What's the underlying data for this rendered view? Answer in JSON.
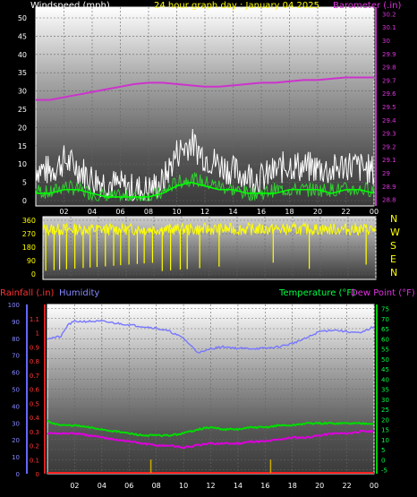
{
  "chart_data": [
    {
      "type": "line",
      "panel": "wind_barometer",
      "title": "24 hour graph day : January 04 2025",
      "left_axis_label": "Windspeed (mph)",
      "right_axis_label": "Barometer (.in)",
      "x_tick_labels": [
        "02",
        "04",
        "06",
        "08",
        "10",
        "12",
        "14",
        "16",
        "18",
        "20",
        "22",
        "00"
      ],
      "left_ticks": [
        0,
        5,
        10,
        15,
        20,
        25,
        30,
        35,
        40,
        45,
        50
      ],
      "left_range": [
        0,
        50
      ],
      "right_ticks": [
        "28.8",
        "28.9",
        "29",
        "29.1",
        "29.2",
        "29.3",
        "29.4",
        "29.5",
        "29.6",
        "29.7",
        "29.8",
        "29.9",
        "30",
        "30.1",
        "30.2"
      ],
      "right_range": [
        28.75,
        30.25
      ],
      "colors": {
        "gust": "#ffffff",
        "wind": "#33cc33",
        "average": "#00ff00",
        "barometer": "#cc33cc"
      },
      "series": [
        {
          "key": "barometer",
          "axis": "right",
          "x": [
            0,
            1,
            2,
            3,
            4,
            5,
            6,
            7,
            8,
            9,
            10,
            11,
            12,
            13,
            14,
            15,
            16,
            17,
            18,
            19,
            20,
            21,
            22,
            23,
            24
          ],
          "values": [
            29.55,
            29.55,
            29.57,
            29.59,
            29.61,
            29.63,
            29.65,
            29.67,
            29.68,
            29.68,
            29.67,
            29.66,
            29.65,
            29.65,
            29.66,
            29.67,
            29.68,
            29.68,
            29.69,
            29.7,
            29.7,
            29.71,
            29.72,
            29.72,
            29.72
          ]
        },
        {
          "key": "gust",
          "axis": "left",
          "x": [
            0,
            1,
            2,
            3,
            4,
            5,
            6,
            7,
            8,
            9,
            10,
            11,
            12,
            13,
            14,
            15,
            16,
            17,
            18,
            19,
            20,
            21,
            22,
            23,
            24
          ],
          "values": [
            9,
            8,
            11,
            9,
            6,
            5,
            4,
            3,
            3,
            5,
            13,
            16,
            12,
            10,
            8,
            7,
            6,
            8,
            10,
            9,
            9,
            8,
            10,
            9,
            8
          ]
        },
        {
          "key": "wind",
          "axis": "left",
          "x": [
            0,
            1,
            2,
            3,
            4,
            5,
            6,
            7,
            8,
            9,
            10,
            11,
            12,
            13,
            14,
            15,
            16,
            17,
            18,
            19,
            20,
            21,
            22,
            23,
            24
          ],
          "values": [
            3,
            2,
            4,
            3,
            2,
            1,
            1,
            1,
            1,
            2,
            5,
            6,
            5,
            4,
            3,
            2,
            2,
            3,
            3,
            3,
            3,
            3,
            3,
            3,
            3
          ]
        },
        {
          "key": "average",
          "axis": "left",
          "x": [
            0,
            1,
            2,
            3,
            4,
            5,
            6,
            7,
            8,
            9,
            10,
            11,
            12,
            13,
            14,
            15,
            16,
            17,
            18,
            19,
            20,
            21,
            22,
            23,
            24
          ],
          "values": [
            2,
            2,
            3,
            3,
            2,
            1,
            1,
            1,
            1,
            2,
            4,
            5,
            4,
            3,
            3,
            2,
            2,
            2,
            3,
            3,
            3,
            2,
            3,
            3,
            2
          ]
        }
      ]
    },
    {
      "type": "scatter",
      "panel": "wind_direction",
      "left_ticks": [
        0,
        90,
        180,
        270,
        360
      ],
      "right_labels": [
        "N",
        "W",
        "S",
        "E",
        "N"
      ],
      "range": [
        0,
        360
      ],
      "color": "#ffff00",
      "typical_values": [
        320,
        300,
        330,
        260,
        310
      ],
      "drop_times": [
        0.2,
        0.8,
        1.2,
        1.7,
        2.3,
        2.9,
        3.4,
        3.9,
        4.5,
        5.1,
        5.6,
        6.2,
        6.8,
        7.3,
        7.9,
        8.6,
        9.2,
        9.9,
        10.4,
        11.3,
        12.7,
        16.6,
        19.2,
        23.3
      ]
    },
    {
      "type": "line",
      "panel": "rain_humidity_temperature",
      "left_axis_labels": [
        "Rainfall (.in)",
        "Humidity"
      ],
      "right_axis_labels": [
        "Temperature (°F)",
        "Dew Point (°F)"
      ],
      "x_tick_labels": [
        "02",
        "04",
        "06",
        "08",
        "10",
        "12",
        "14",
        "16",
        "18",
        "20",
        "22",
        "00"
      ],
      "humidity_ticks": [
        0,
        10,
        20,
        30,
        40,
        50,
        60,
        70,
        80,
        90,
        100
      ],
      "rain_ticks": [
        "0",
        "0.1",
        "0.2",
        "0.3",
        "0.4",
        "0.5",
        "0.6",
        "0.7",
        "0.8",
        "0.9",
        "1",
        "1.1"
      ],
      "temp_ticks": [
        -5,
        0,
        5,
        10,
        15,
        20,
        25,
        30,
        35,
        40,
        45,
        50,
        55,
        60,
        65,
        70,
        75
      ],
      "temp_range": [
        -7,
        77
      ],
      "colors": {
        "rain": "#ff2222",
        "rain_rate": "#ccaa00",
        "humidity": "#7777ff",
        "temperature": "#00dd00",
        "dew_point": "#dd00dd"
      },
      "series": [
        {
          "key": "humidity",
          "x": [
            0,
            1,
            1.5,
            2,
            3,
            4,
            5,
            6,
            7,
            8,
            9,
            10,
            10.5,
            11,
            11.5,
            12,
            13,
            14,
            15,
            16,
            17,
            18,
            19,
            20,
            21,
            22,
            23,
            24
          ],
          "values": [
            80,
            81,
            88,
            90,
            90,
            90,
            89,
            88,
            87,
            86,
            84,
            80,
            76,
            72,
            72,
            74,
            75,
            74,
            74,
            74,
            75,
            77,
            80,
            84,
            85,
            84,
            83,
            87
          ]
        },
        {
          "key": "temperature",
          "x": [
            0,
            1,
            2,
            3,
            4,
            5,
            6,
            7,
            8,
            9,
            10,
            11,
            12,
            13,
            14,
            15,
            16,
            17,
            18,
            19,
            20,
            21,
            22,
            23,
            24
          ],
          "values": [
            19,
            17,
            17,
            16,
            15,
            14,
            13,
            12,
            12,
            12,
            13,
            15,
            16,
            15,
            15,
            16,
            16,
            17,
            17,
            18,
            18,
            18,
            18,
            18,
            18
          ]
        },
        {
          "key": "dew_point",
          "x": [
            0,
            1,
            2,
            3,
            4,
            5,
            6,
            7,
            8,
            9,
            10,
            11,
            12,
            13,
            14,
            15,
            16,
            17,
            18,
            19,
            20,
            21,
            22,
            23,
            24
          ],
          "values": [
            13,
            13,
            13,
            12,
            11,
            10,
            9,
            8,
            7,
            7,
            6,
            7,
            8,
            8,
            8,
            9,
            9,
            10,
            11,
            11,
            12,
            13,
            13,
            14,
            14
          ]
        },
        {
          "key": "rain",
          "x": [
            0,
            24
          ],
          "values": [
            0,
            0
          ]
        },
        {
          "key": "rain_rate",
          "x": [
            7.6,
            16.4
          ],
          "values": [
            0.1,
            0.1
          ]
        }
      ]
    }
  ]
}
